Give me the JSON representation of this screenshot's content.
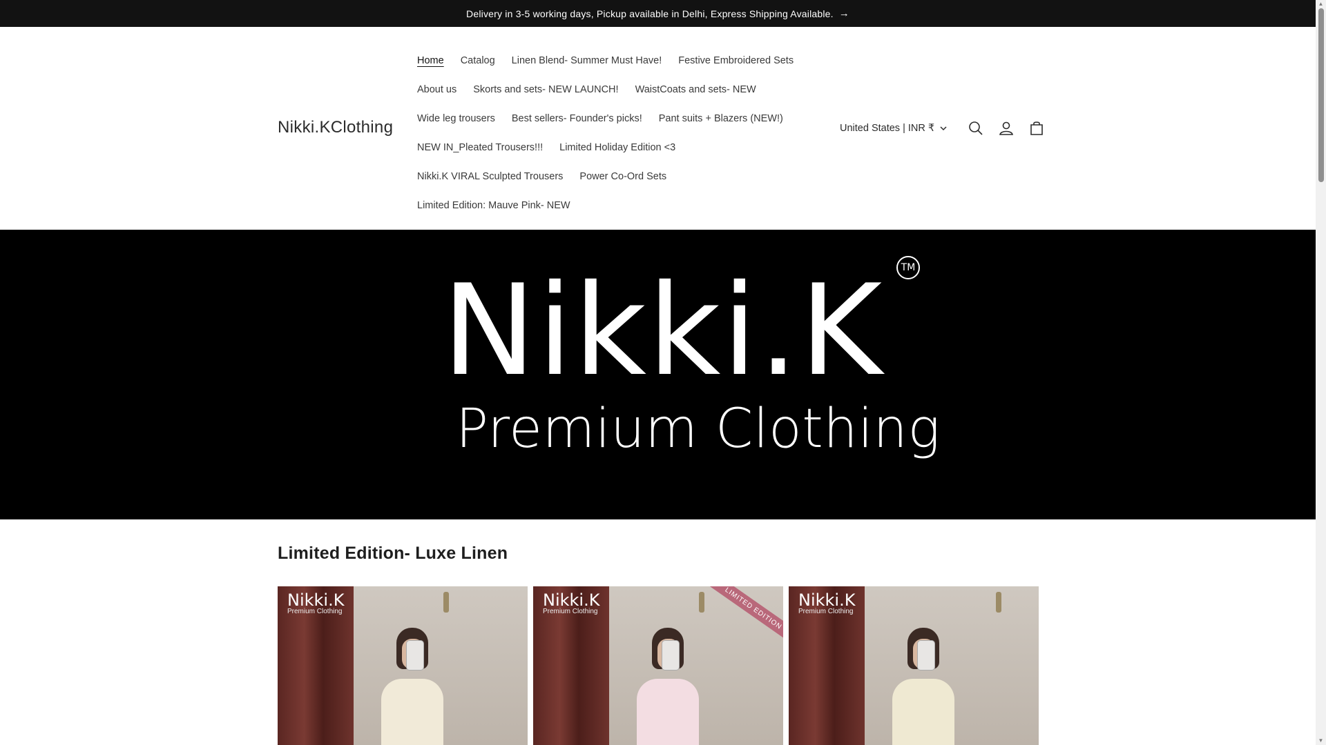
{
  "announcement": {
    "text": "Delivery in 3-5 working days, Pickup available in Delhi, Express Shipping Available.",
    "arrow": "→"
  },
  "header": {
    "logo": "Nikki.KClothing",
    "country": "United States | INR ₹",
    "nav": [
      [
        "Home",
        "Catalog",
        "Linen Blend- Summer Must Have!",
        "Festive Embroidered Sets"
      ],
      [
        "About us",
        "Skorts and sets- NEW LAUNCH!",
        "WaistCoats and sets- NEW"
      ],
      [
        "Wide leg trousers",
        "Best sellers- Founder's picks!",
        "Pant suits + Blazers (NEW!)"
      ],
      [
        "NEW IN_Pleated Trousers!!!",
        "Limited Holiday Edition <3"
      ],
      [
        "Nikki.K VIRAL Sculpted Trousers",
        "Power Co-Ord Sets"
      ],
      [
        "Limited Edition: Mauve Pink- NEW"
      ]
    ],
    "active_nav": "Home",
    "icons": [
      "search-icon",
      "account-icon",
      "cart-icon"
    ]
  },
  "hero": {
    "brand": "Nikki.K",
    "subtitle": "Premium Clothing",
    "tm": "TM"
  },
  "section": {
    "title": "Limited Edition- Luxe Linen",
    "cards": [
      {
        "logo": "Nikki.K",
        "logo_sub": "Premium Clothing",
        "outfit_color": "#f1ead8",
        "ribbon": ""
      },
      {
        "logo": "Nikki.K",
        "logo_sub": "Premium Clothing",
        "outfit_color": "#f3dde2",
        "ribbon": "LIMITED EDITION"
      },
      {
        "logo": "Nikki.K",
        "logo_sub": "Premium Clothing",
        "outfit_color": "#efe9d2",
        "ribbon": ""
      }
    ]
  },
  "colors": {
    "announcement_bg": "#121212",
    "hero_bg": "#000000",
    "text": "#121212"
  }
}
